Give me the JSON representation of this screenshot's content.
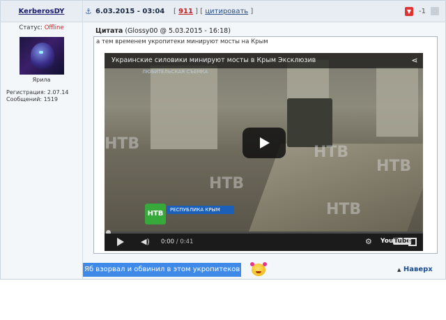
{
  "post": {
    "author": "KerberosDY",
    "date": "6.03.2015 - 03:04",
    "links": {
      "open_bracket": "[",
      "number": "911",
      "mid": "] [",
      "quote_link": "цитировать",
      "close_bracket": "]"
    },
    "rating": "-1"
  },
  "user": {
    "status_label": "Статус:",
    "status_value": "Offline",
    "avatar_caption": "Ярила",
    "registration": "Регистрация: 2.07.14",
    "messages": "Сообщений: 1519"
  },
  "quote": {
    "label": "Цитата",
    "source": "(Glossy00 @ 5.03.2015 - 16:18)",
    "text": "а тем временем укропитеки минируют мосты на Крым"
  },
  "video": {
    "title": "Украинские силовики минируют мосты в Крым Эксклюзив",
    "overlay_text": "ЛЮБИТЕЛЬСКАЯ СЪЕМКА",
    "channel_logo": "НТВ",
    "banner": "РЕСПУБЛИКА КРЫМ",
    "watermark": "НТВ",
    "time_current": "0:00",
    "time_sep": " / ",
    "time_total": "0:41",
    "youtube_a": "You",
    "youtube_b": "Tube"
  },
  "reply": {
    "text": "Яб взорвал и обвинил в этом укропитеков"
  },
  "nav": {
    "top_link": "Наверх"
  },
  "colors": {
    "header_bg": "#e7edf3",
    "offline": "#cc2222",
    "reply_highlight": "#3f8ae8",
    "link": "#1d4e8f"
  }
}
